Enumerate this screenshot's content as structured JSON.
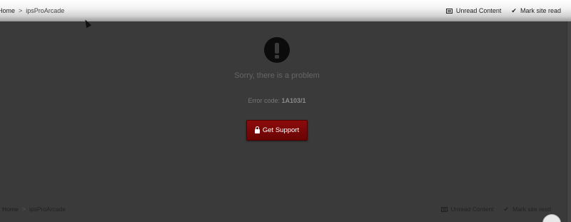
{
  "header": {
    "breadcrumb": {
      "home": "Home",
      "separator": ">",
      "current": "ipsProArcade"
    },
    "actions": {
      "unread": "Unread Content",
      "mark_read": "Mark site read"
    }
  },
  "error": {
    "icon": "exclamation-circle-icon",
    "message": "Sorry, there is a problem",
    "code_label": "Error code:",
    "code_value": "1A103/1",
    "support_button": "Get Support"
  },
  "footer": {
    "breadcrumb": {
      "home": "Home",
      "separator": ">",
      "current": "ipsProArcade"
    },
    "actions": {
      "unread": "Unread Content",
      "mark_read": "Mark site read"
    }
  },
  "colors": {
    "background": "#3a3a3a",
    "button": "#8c0b0b",
    "header_light": "#ffffff"
  }
}
